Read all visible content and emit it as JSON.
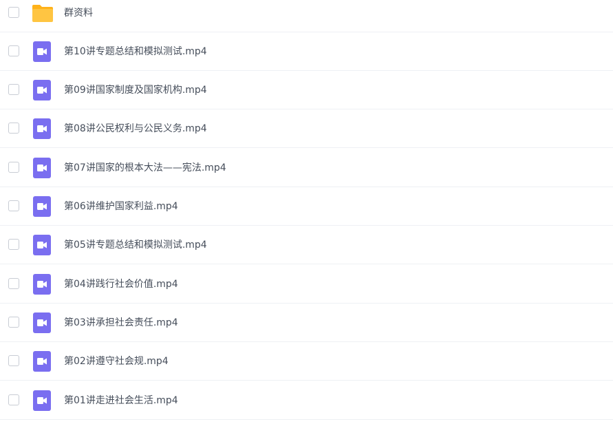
{
  "colors": {
    "folder_body": "#FFC542",
    "folder_tab": "#FFB21A",
    "video_bg": "#7A6EF0",
    "text": "#454D5A",
    "checkbox_border": "#C8CCD4",
    "divider": "#EEF0F4"
  },
  "files": [
    {
      "name": "群资料",
      "type": "folder",
      "icon": "folder-icon"
    },
    {
      "name": "第10讲专题总结和模拟测试.mp4",
      "type": "video",
      "icon": "video-file-icon"
    },
    {
      "name": "第09讲国家制度及国家机构.mp4",
      "type": "video",
      "icon": "video-file-icon"
    },
    {
      "name": "第08讲公民权利与公民义务.mp4",
      "type": "video",
      "icon": "video-file-icon"
    },
    {
      "name": "第07讲国家的根本大法——宪法.mp4",
      "type": "video",
      "icon": "video-file-icon"
    },
    {
      "name": "第06讲维护国家利益.mp4",
      "type": "video",
      "icon": "video-file-icon"
    },
    {
      "name": "第05讲专题总结和模拟测试.mp4",
      "type": "video",
      "icon": "video-file-icon"
    },
    {
      "name": "第04讲践行社会价值.mp4",
      "type": "video",
      "icon": "video-file-icon"
    },
    {
      "name": "第03讲承担社会责任.mp4",
      "type": "video",
      "icon": "video-file-icon"
    },
    {
      "name": "第02讲遵守社会规.mp4",
      "type": "video",
      "icon": "video-file-icon"
    },
    {
      "name": "第01讲走进社会生活.mp4",
      "type": "video",
      "icon": "video-file-icon"
    }
  ]
}
